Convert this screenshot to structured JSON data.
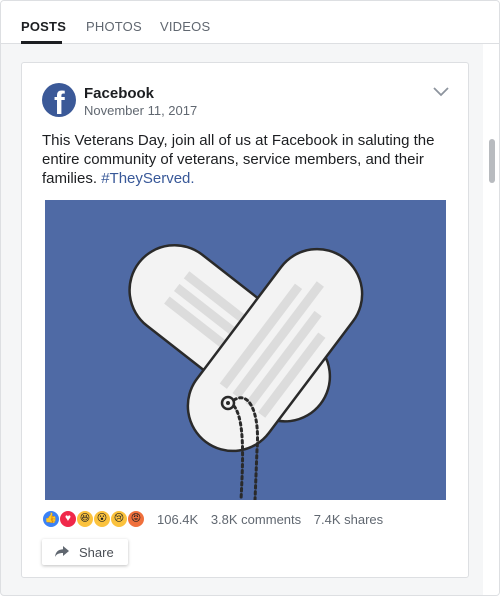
{
  "tabs": [
    {
      "label": "POSTS",
      "active": true
    },
    {
      "label": "PHOTOS",
      "active": false
    },
    {
      "label": "VIDEOS",
      "active": false
    }
  ],
  "post": {
    "page_name": "Facebook",
    "date": "November 11, 2017",
    "text": "This Veterans Day, join all of us at Facebook in saluting the entire community of veterans, service members, and their families.",
    "hashtag": "#TheyServed.",
    "reactions_count": "106.4K",
    "comments": "3.8K comments",
    "shares": "7.4K shares",
    "share_label": "Share",
    "image_icon": "dog-tags-heart-illustration"
  },
  "colors": {
    "brand": "#3b5998",
    "image_bg": "#4f6aa5",
    "hashtag": "#385898"
  },
  "icons": {
    "avatar": "facebook-logo-icon",
    "menu": "chevron-down-icon",
    "share": "share-arrow-icon",
    "reactions": [
      "like-icon",
      "love-icon",
      "haha-icon",
      "wow-icon",
      "sad-icon",
      "angry-icon"
    ]
  }
}
